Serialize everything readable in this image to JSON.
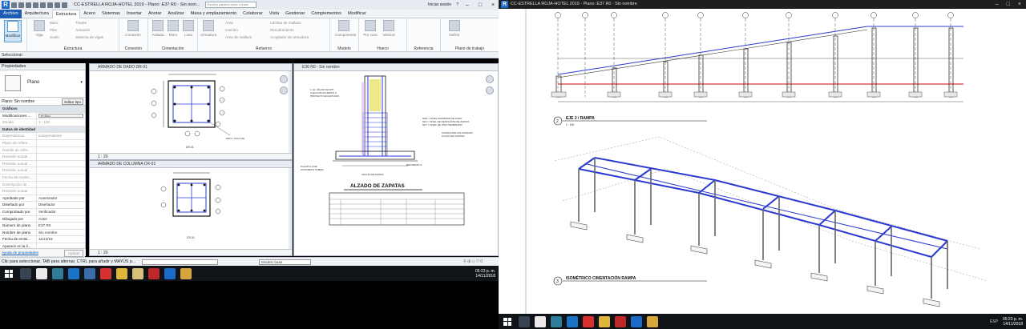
{
  "left_window": {
    "title": "CC-ESTRELLA ROJA-HOTEL 2019 - Plano: E37 R0 - Sin nom...",
    "search_placeholder": "Escriba palabra clave o frase",
    "signin": "Iniciar sesión",
    "ribbon_tabs": [
      "Archivo",
      "Arquitectura",
      "Estructura",
      "Acero",
      "Sistemas",
      "Insertar",
      "Anotar",
      "Analizar",
      "Masa y emplazamiento",
      "Colaborar",
      "Vista",
      "Gestionar",
      "Complementos",
      "Modificar"
    ],
    "active_tab": "Estructura",
    "ribbon": {
      "modificar": "Modificar",
      "viga": "Viga",
      "muro": "Muro",
      "pilar": "Pilar",
      "suelo": "Suelo",
      "tirante": "Tirante",
      "armazon": "Armazón",
      "sistema_vigas": "Sistema de vigas",
      "conexion": "Conexión",
      "aislada": "Aislada",
      "muro2": "Muro",
      "losa": "Losa",
      "armadura": "Armadura",
      "area": "Área",
      "camino": "Camino",
      "area_mallazo": "Área de mallazo",
      "lamina_mallazo": "Lámina de mallazo",
      "recubrimiento": "Recubrimiento",
      "acoplador": "Acoplador de armadura",
      "componente": "Componente",
      "por_cara": "Por cara",
      "vertical": "Vertical",
      "definir": "Definir",
      "g_seleccionar": "Seleccionar",
      "g_estructura": "Estructura",
      "g_conexion": "Conexión",
      "g_cimentacion": "Cimentación",
      "g_refuerzo": "Refuerzo",
      "g_modelo": "Modelo",
      "g_hueco": "Hueco",
      "g_referencia": "Referencia",
      "g_plano": "Plano de trabajo"
    },
    "properties": {
      "header": "Propiedades",
      "type_name": "Plano",
      "instance": "Plano: Sin nombre",
      "edit_type": "Editar tipo",
      "rows": [
        {
          "k": "Gráficos",
          "v": "",
          "section": true
        },
        {
          "k": "Modificaciones ...",
          "v": "Editar...",
          "button": true
        },
        {
          "k": "Escala",
          "v": "1 : 150",
          "grey": true
        },
        {
          "k": "Datos de identidad",
          "v": "",
          "section": true
        },
        {
          "k": "Dependencia",
          "v": "Independiente",
          "grey": true
        },
        {
          "k": "Plano de refere...",
          "v": "",
          "grey": true
        },
        {
          "k": "Detalle de refer...",
          "v": "",
          "grey": true
        },
        {
          "k": "Revisión actual ...",
          "v": "",
          "grey": true
        },
        {
          "k": "Revisión actual ...",
          "v": "",
          "grey": true
        },
        {
          "k": "Revisión actual ...",
          "v": "",
          "grey": true
        },
        {
          "k": "Fecha de revisió...",
          "v": "",
          "grey": true
        },
        {
          "k": "Descripción de ...",
          "v": "",
          "grey": true
        },
        {
          "k": "Revisión actual",
          "v": "",
          "grey": true
        },
        {
          "k": "Aprobado por",
          "v": "Autorizador"
        },
        {
          "k": "Diseñado por",
          "v": "Diseñador"
        },
        {
          "k": "Comprobado por",
          "v": "Verificador"
        },
        {
          "k": "Dibujado por",
          "v": "Autor"
        },
        {
          "k": "Número de plano",
          "v": "E37 R0"
        },
        {
          "k": "Nombre de plano",
          "v": "Sin nombre"
        },
        {
          "k": "Fecha de emisi...",
          "v": "11/14/18"
        },
        {
          "k": "Aparece en la li...",
          "v": ""
        },
        {
          "k": "Revisiones en...",
          "v": ""
        }
      ],
      "help_link": "Ayuda de propiedades",
      "apply": "Aplicar"
    },
    "views": {
      "v1_title": "ARMADO DE DADO DR-01",
      "v2_title": "ARMADO DE COLUMNA CR-01",
      "v3_title": "E36 R0 - Sin nombre",
      "scale": "1 : 20",
      "v3_heading": "ALZADO DE ZAPATAS",
      "v1_caption": "DR-01",
      "v2_caption": "CR-01"
    },
    "status": {
      "message": "Clic para seleccionar, TAB para alternar, CTRL para añadir y MAYÚS p...",
      "model": "Modelo base",
      "count": "0"
    },
    "clock": {
      "time": "05:23 p. m.",
      "date": "14/11/2018"
    }
  },
  "right_window": {
    "title": "CC-ESTRELLA ROJA-HOTEL 2019 - Plano: E37 R0 - Sin nombre",
    "label_eje": "EJE 2 / RAMPA",
    "label_eje_num": "2",
    "label_eje_scale": "1 : 150",
    "label_iso": "ISOMÉTRICO CIMENTACIÓN RAMPA",
    "label_iso_num": "3",
    "clock": {
      "time": "05:23 p. m.",
      "date": "14/11/2018"
    },
    "lang": "ESP"
  },
  "colors": {
    "revit_blue": "#1b6ac9",
    "file_tab": "#1e5cb3",
    "beam_blue": "#2a3ad0",
    "red_line": "#d40000",
    "taskbar": "#101418"
  }
}
